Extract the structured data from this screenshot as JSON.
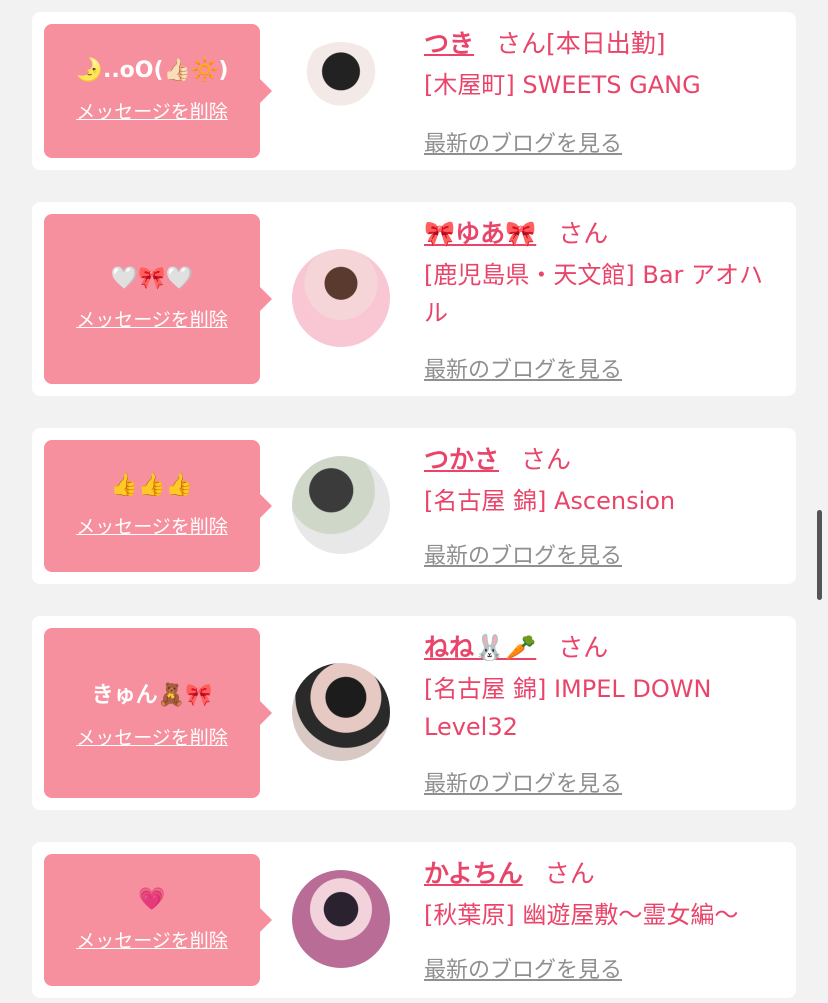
{
  "delete_label": "メッセージを削除",
  "blog_label": "最新のブログを見る",
  "honorific": "さん",
  "entries": [
    {
      "message": "🌛..oO(👍🏻🔆)",
      "name": "つき",
      "status": "[本日出勤]",
      "shop": "[木屋町] SWEETS GANG"
    },
    {
      "message": "🤍🎀🤍",
      "name": "🎀ゆあ🎀",
      "status": "",
      "shop": "[鹿児島県・天文館] Bar アオハル"
    },
    {
      "message": "👍👍👍",
      "name": "つかさ",
      "status": "",
      "shop": "[名古屋 錦] Ascension"
    },
    {
      "message": "きゅん🧸🎀",
      "name": "ねね🐰🥕",
      "status": "",
      "shop": "[名古屋 錦] IMPEL DOWN Level32"
    },
    {
      "message": "💗",
      "name": "かよちん",
      "status": "",
      "shop": "[秋葉原] 幽遊屋敷〜霊女編〜"
    }
  ],
  "colors": {
    "accent": "#e9456a",
    "bubble": "#f7909e",
    "link_gray": "#8f8f8f",
    "bg": "#f2f2f2"
  }
}
